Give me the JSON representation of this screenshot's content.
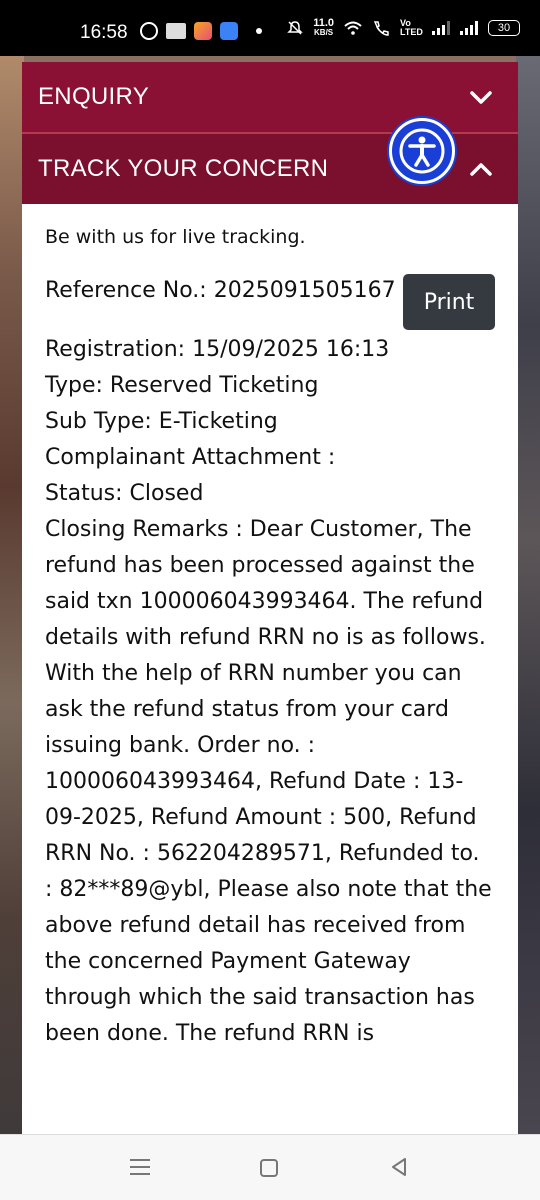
{
  "status_bar": {
    "time": "16:58",
    "speed_value": "11.0",
    "speed_unit": "KB/S",
    "volte": "Vo LTED",
    "battery": "30"
  },
  "accordion": {
    "enquiry_label": "ENQUIRY",
    "track_label": "TRACK YOUR CONCERN"
  },
  "tracking": {
    "intro": "Be with us for live tracking.",
    "reference": "Reference No.: 2025091505167",
    "print_label": "Print",
    "registration": "Registration: 15/09/2025 16:13",
    "type": "Type: Reserved Ticketing",
    "sub_type": "Sub Type: E-Ticketing",
    "attachment": "Complainant Attachment :",
    "status": "Status: Closed",
    "closing_remarks": "Closing Remarks : Dear Customer, The refund has been processed against the said txn 100006043993464. The refund details with refund RRN no is as follows. With the help of RRN number you can ask the refund status from your card issuing bank. Order no. : 100006043993464, Refund Date : 13-09-2025, Refund Amount : 500, Refund RRN No. : 562204289571, Refunded to. : 82***89@ybl, Please also note that the above refund detail has received from the concerned Payment Gateway through which the said transaction has been done. The refund RRN is"
  }
}
